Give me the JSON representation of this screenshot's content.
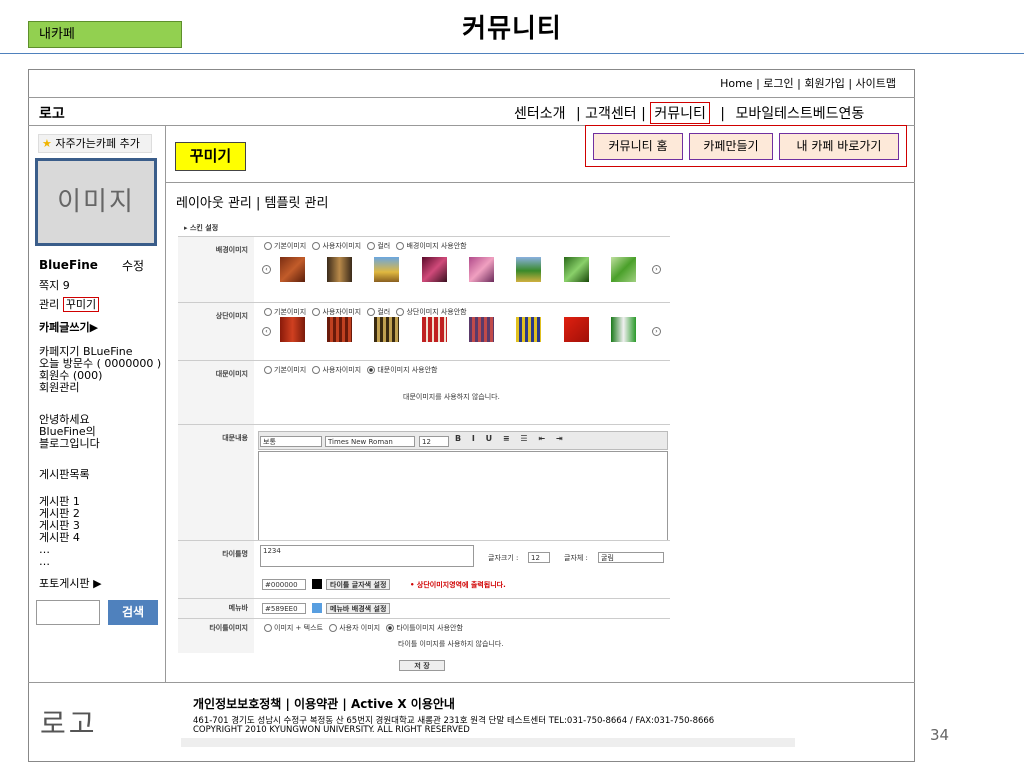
{
  "slide": {
    "title": "커뮤니티",
    "tag": "내카페",
    "page_number": "34"
  },
  "header": {
    "utility_links": "Home | 로그인 | 회원가입 | 사이트맵",
    "logo": "로고",
    "nav": {
      "center_intro": "센터소개",
      "sep1": "|",
      "customer_center": "고객센터",
      "sep2": "|",
      "community": "커뮤니티",
      "sep3": "|",
      "mobile": "모바일테스트베드연동"
    }
  },
  "sidebar": {
    "favorite": "자주가는카페 추가",
    "image_placeholder": "이미지",
    "cafe_name": "BlueFine",
    "edit": "수정",
    "notes": "쪽지 9",
    "manage_label": "관리",
    "decorate_link": "꾸미기",
    "write_post": "카페글쓰기▶",
    "info_lines": [
      "카페지기 BLueFine",
      "오늘 방문수 ( 0000000 )",
      "회원수 (000)",
      "회원관리"
    ],
    "greeting_lines": [
      "안녕하세요",
      "BlueFine의",
      "블로그입니다"
    ],
    "board_list_title": "게시판목록",
    "boards": [
      "게시판 1",
      "게시판 2",
      "게시판 3",
      "게시판 4",
      "…",
      "…"
    ],
    "photo_board": "포토게시판 ▶",
    "search_button": "검색"
  },
  "content": {
    "section_title": "꾸미기",
    "sub_menu": {
      "home": "커뮤니티 홈",
      "make_cafe": "카페만들기",
      "my_cafe": "내 카페 바로가기"
    },
    "layout_tabs": "레이아웃 관리 | 템플릿 관리",
    "skin_settings": {
      "heading": "스킨 설정",
      "bg_image": {
        "label": "배경이미지",
        "options": [
          "기본이미지",
          "사용자이미지",
          "컬러",
          "배경이미지 사용안함"
        ]
      },
      "top_image": {
        "label": "상단이미지",
        "options": [
          "기본이미지",
          "사용자이미지",
          "컬러",
          "상단이미지 사용안함"
        ]
      },
      "banner_image": {
        "label": "대문이미지",
        "options": [
          "기본이미지",
          "사용자이미지",
          "대문이미지 사용안함"
        ],
        "note": "대문이미지를 사용하지 않습니다."
      },
      "banner_content": {
        "label": "대문내용",
        "font_style": "보통",
        "font_name": "Times New Roman",
        "font_size": "12"
      },
      "title_bar": {
        "label": "타이틀명",
        "value": "1234",
        "font_size_label": "글자크기 :",
        "font_size": "12",
        "font_face_label": "글자체 :",
        "font_face": "굴림",
        "color_code": "#000000",
        "color_button": "타이틀 글자색 설정",
        "hint": "• 상단이미지영역에 출력됩니다."
      },
      "menu_bar": {
        "label": "메뉴바",
        "color_code": "#589EE0",
        "color_button": "메뉴바 배경색 설정"
      },
      "title_image": {
        "label": "타이틀이미지",
        "options": [
          "이미지 + 텍스트",
          "사용자 이미지",
          "타이틀이미지 사용안함"
        ],
        "note": "타이틀 이미지를 사용하지 않습니다."
      },
      "save_button": "저 장"
    }
  },
  "footer": {
    "logo": "로고",
    "links": "개인정보보호정책 | 이용약관 | Active X 이용안내",
    "address": "461-701 경기도 성남시 수정구 복정동 산 65번지 경원대학교 새롬관 231호 원격 단말 테스트센터 TEL:031-750-8664 / FAX:031-750-8666",
    "copyright": "COPYRIGHT 2010 KYUNGWON UNIVERSITY. ALL RIGHT RESERVED"
  },
  "colors": {
    "tag_green": "#92d050",
    "title_bar_color": "#000000",
    "menu_bar_color": "#589EE0",
    "highlight_red": "#d00000",
    "sub_menu_bg": "#fde9d9",
    "section_yellow": "#ffff00",
    "search_blue": "#4f81bd"
  }
}
